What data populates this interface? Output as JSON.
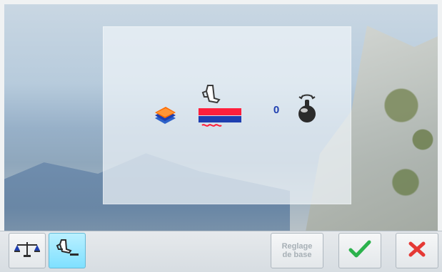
{
  "settings_screen": {
    "value": "0"
  },
  "footer": {
    "reset_button": "Reglage\nde base"
  },
  "colors": {
    "accent_blue": "#1f3fb0",
    "check_green": "#2bb24c",
    "cancel_red": "#e53935"
  },
  "icons": {
    "fabric_stack": "stack-icon",
    "presser_foot": "presser-foot-icon",
    "knob": "knob-icon",
    "balance": "scale-icon",
    "foot_toggle": "foot-toggle-icon",
    "confirm": "check-icon",
    "cancel": "close-icon"
  }
}
